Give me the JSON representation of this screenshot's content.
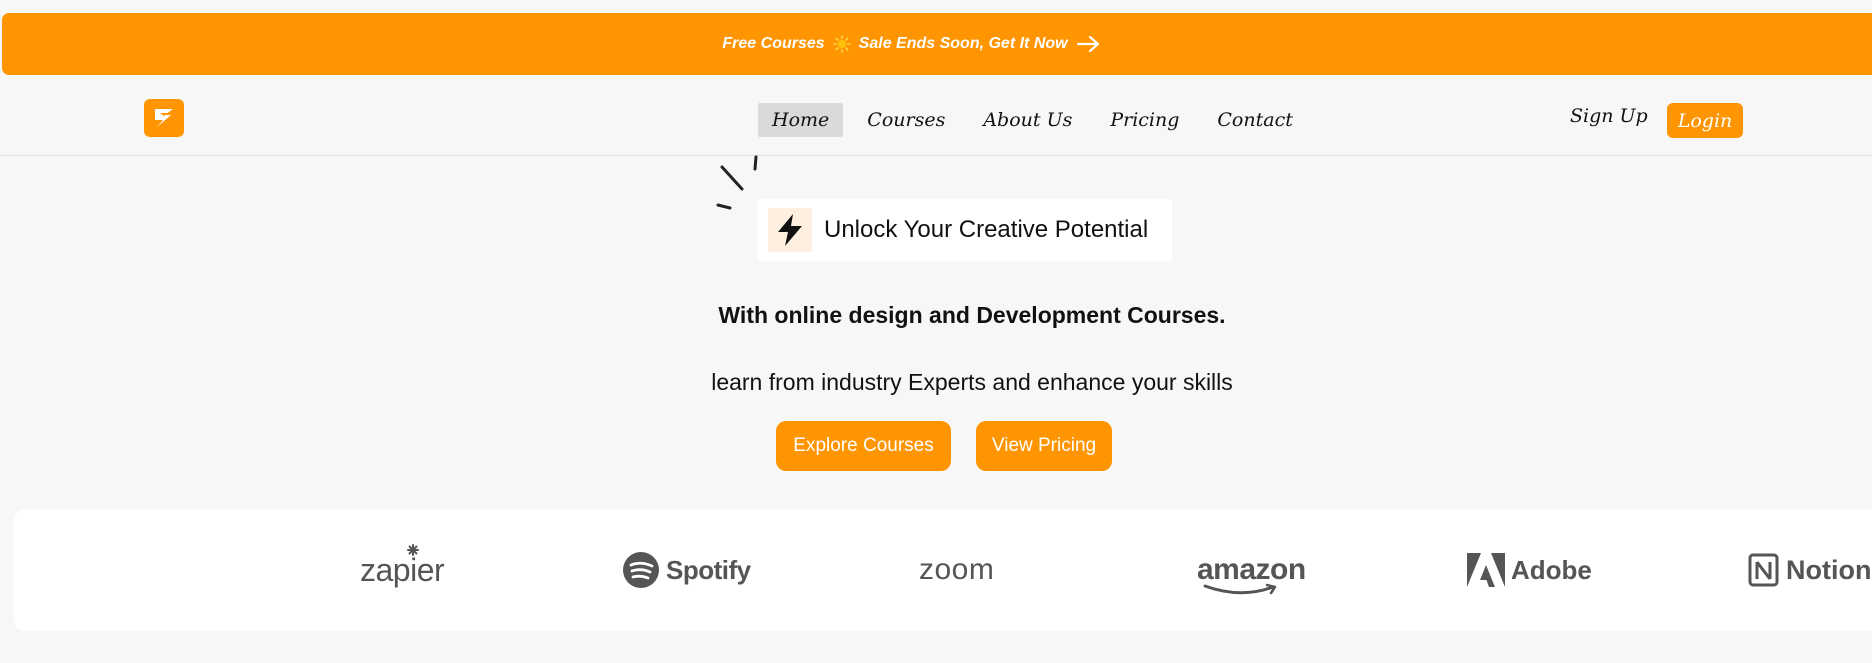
{
  "banner": {
    "text_left": "Free Courses",
    "text_right": "Sale Ends Soon, Get It Now",
    "icons": [
      "sun-icon",
      "arrow-right-icon"
    ]
  },
  "nav": {
    "logo_icon": "logo-s-icon",
    "links": [
      {
        "label": "Home",
        "active": true
      },
      {
        "label": "Courses"
      },
      {
        "label": "About Us"
      },
      {
        "label": "Pricing"
      },
      {
        "label": "Contact"
      }
    ],
    "signup_label": "Sign Up",
    "login_label": "Login"
  },
  "hero": {
    "tagline_icon": "lightning-bolt-icon",
    "tagline": "Unlock Your Creative Potential",
    "headline": "With online design and Development Courses.",
    "subline": "learn from industry Experts and enhance your skills",
    "explore_label": "Explore Courses",
    "pricing_label": "View Pricing"
  },
  "brands": {
    "zapier": "zapier",
    "spotify": "Spotify",
    "zoom": "zoom",
    "amazon": "amazon",
    "adobe": "Adobe",
    "notion": "Notion"
  },
  "colors": {
    "accent": "#ff9500",
    "background": "#f7f7f7",
    "active_nav": "#dadada",
    "brand_gray": "#555555"
  }
}
